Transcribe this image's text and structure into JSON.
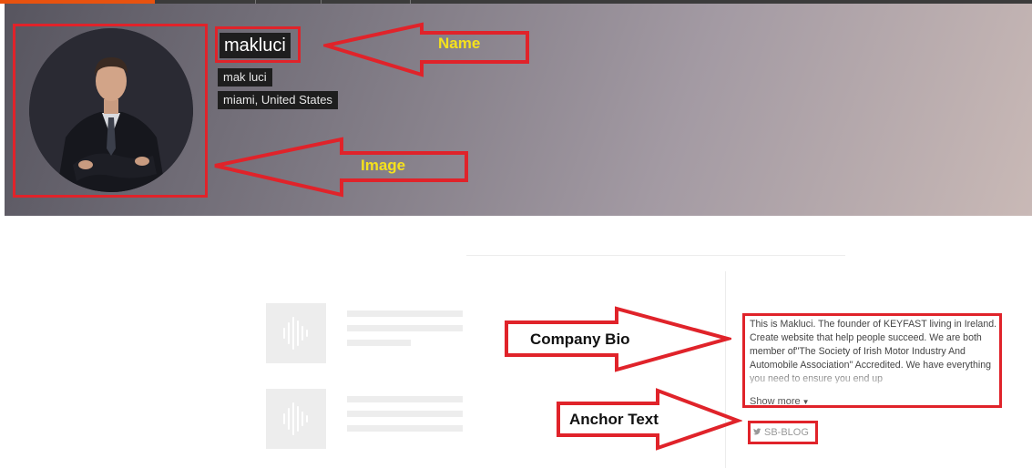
{
  "profile": {
    "username": "makluci",
    "full_name": "mak luci",
    "location": "miami, United States",
    "avatar_icon": "person-in-suit-photo"
  },
  "annotations": {
    "name_label": "Name",
    "image_label": "Image",
    "company_bio_label": "Company Bio",
    "anchor_text_label": "Anchor Text",
    "frame_color": "#e0232a",
    "label_yellow": "#f5e11c"
  },
  "bio": {
    "text": "This is Makluci. The founder of KEYFAST living in Ireland. Create website that help people succeed. We are both member of\"The Society of Irish Motor Industry And Automobile Association\" Accredited. We have everything you need to ensure you end up",
    "show_more": "Show more",
    "show_more_icon": "caret-down-icon"
  },
  "links": {
    "anchor_text": "SB-BLOG",
    "anchor_icon": "twitter-icon"
  },
  "placeholders": {
    "thumb_icon": "audio-waveform-icon"
  },
  "theme": {
    "accent": "#e8520f",
    "topbar": "#3b3b3b"
  }
}
